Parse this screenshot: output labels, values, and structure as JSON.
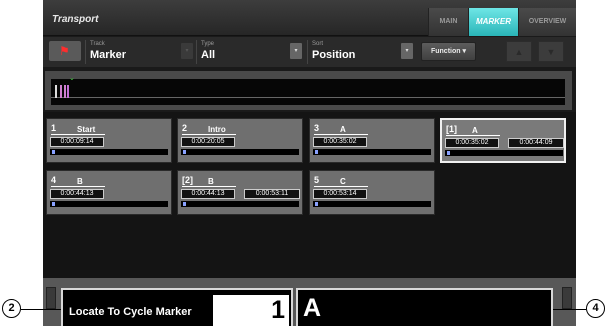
{
  "header": {
    "title": "Transport",
    "tabs": [
      "MAIN",
      "MARKER",
      "OVERVIEW"
    ],
    "active_tab": "MARKER"
  },
  "filter_bar": {
    "track": {
      "label": "Track",
      "value": "Marker"
    },
    "type": {
      "label": "Type",
      "value": "All"
    },
    "sort": {
      "label": "Sort",
      "value": "Position"
    },
    "function_label": "Function ▾",
    "dropdown_glyph": "▾",
    "up_glyph": "▲",
    "down_glyph": "▼",
    "flag_glyph": "⚑"
  },
  "overview": {
    "position_glyph": "⌄"
  },
  "markers": [
    {
      "number": "1",
      "name": "Start",
      "start": "0:00:09:14",
      "end": ""
    },
    {
      "number": "2",
      "name": "Intro",
      "start": "0:00:20:05",
      "end": ""
    },
    {
      "number": "3",
      "name": "A",
      "start": "0:00:35:02",
      "end": ""
    },
    {
      "number": "[1]",
      "name": "A",
      "start": "0:00:35:02",
      "end": "0:00:44:09",
      "selected": true
    },
    {
      "number": "4",
      "name": "B",
      "start": "0:00:44:13",
      "end": ""
    },
    {
      "number": "[2]",
      "name": "B",
      "start": "0:00:44:13",
      "end": "0:00:53:11"
    },
    {
      "number": "5",
      "name": "C",
      "start": "0:00:53:14",
      "end": ""
    }
  ],
  "bottom": {
    "locate_label": "Locate To Cycle Marker",
    "locate_number": "1",
    "marker_name": "A"
  },
  "callouts": [
    "2",
    "4"
  ],
  "colors": {
    "accent_tab": "#2ab5b8",
    "flag": "#ff2d2d",
    "overview_marks": "#cf7fd0",
    "position_marker": "#43d63f",
    "position_bar": "#8aa2ff"
  }
}
